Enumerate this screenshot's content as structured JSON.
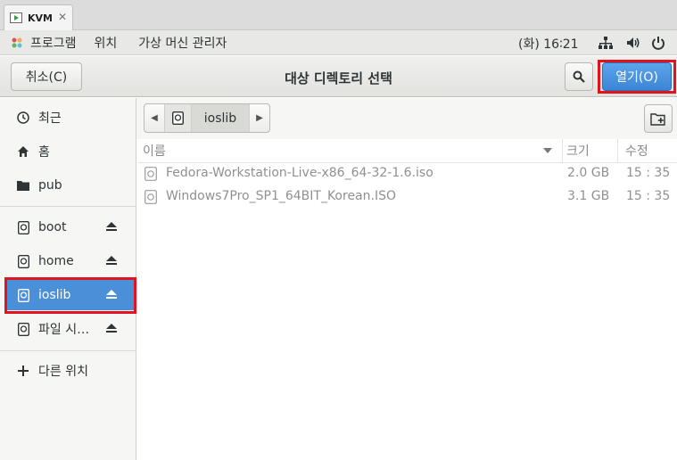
{
  "tab": {
    "title": "KVM",
    "close": "✕"
  },
  "top_panel": {
    "menu": [
      "프로그램",
      "위치",
      "가상 머신 관리자"
    ],
    "clock": "(화) 16∶21"
  },
  "header": {
    "cancel_label": "취소(C)",
    "title": "대상 디렉토리 선택",
    "open_label": "열기(O)"
  },
  "sidebar": {
    "places": [
      "최근",
      "홈",
      "pub"
    ],
    "devices": [
      "boot",
      "home",
      "ioslib",
      "파일 시…"
    ],
    "other": "다른 위치",
    "selected": "ioslib"
  },
  "pathbar": {
    "current": "ioslib"
  },
  "columns": {
    "name": "이름",
    "size": "크기",
    "modified": "수정"
  },
  "files": [
    {
      "name": "Fedora-Workstation-Live-x86_64-32-1.6.iso",
      "size": "2.0 GB",
      "modified": "15 : 35"
    },
    {
      "name": "Windows7Pro_SP1_64BIT_Korean.ISO",
      "size": "3.1 GB",
      "modified": "15 : 35"
    }
  ],
  "colors": {
    "accent": "#4a90d9",
    "highlight_box": "#e2131e"
  }
}
